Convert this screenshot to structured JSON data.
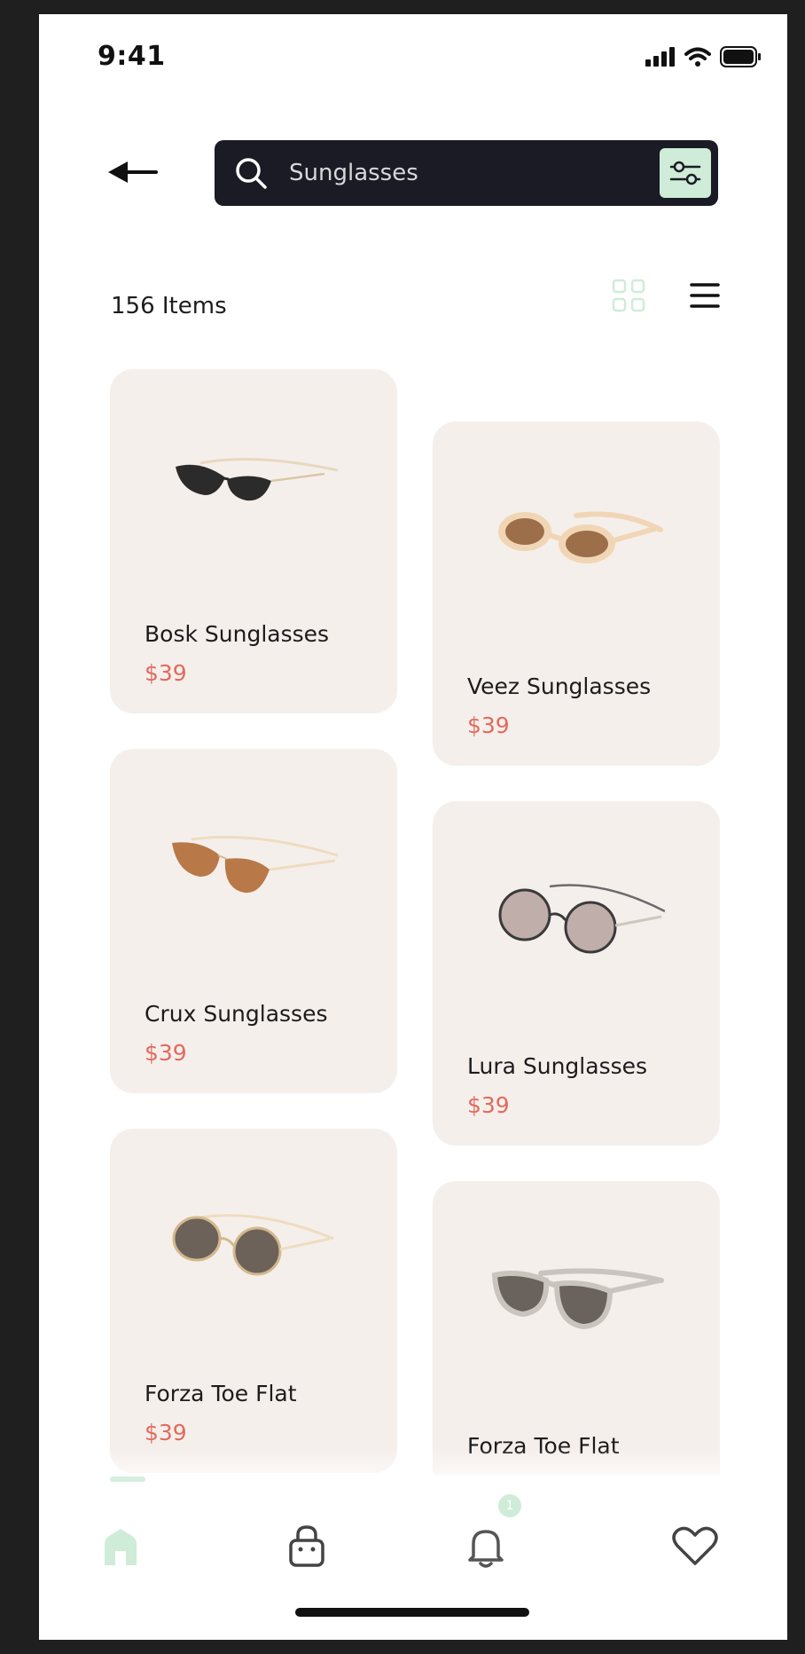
{
  "status_bar": {
    "time": "9:41"
  },
  "search": {
    "placeholder": "Sunglasses"
  },
  "results": {
    "count_label": "156 Items"
  },
  "products": [
    {
      "name": "Bosk Sunglasses",
      "price": "$39"
    },
    {
      "name": "Veez Sunglasses",
      "price": "$39"
    },
    {
      "name": "Crux Sunglasses",
      "price": "$39"
    },
    {
      "name": "Lura Sunglasses",
      "price": "$39"
    },
    {
      "name": "Forza Toe Flat",
      "price": "$39"
    },
    {
      "name": "Forza Toe Flat",
      "price": ""
    }
  ],
  "nav": {
    "items": [
      {
        "icon": "home-icon",
        "active": true
      },
      {
        "icon": "bag-icon",
        "active": false
      },
      {
        "icon": "bell-icon",
        "active": false
      },
      {
        "icon": "heart-icon",
        "active": false
      }
    ],
    "notification_badge": "1"
  },
  "colors": {
    "accent": "#cfecd8",
    "search_bg": "#1a1b24",
    "card_bg": "#f5efec",
    "price": "#e26a5d"
  }
}
